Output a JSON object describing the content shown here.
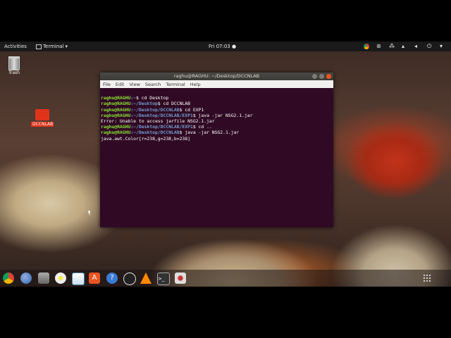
{
  "topbar": {
    "activities": "Activities",
    "app_name": "Terminal",
    "clock": "Fri 07:03 ●"
  },
  "desktop": {
    "trash_label": "Trash",
    "folder_label": "DCCNLAB"
  },
  "terminal": {
    "title": "raghu@RAGHU: ~/Desktop/DCCNLAB",
    "menu": [
      "File",
      "Edit",
      "View",
      "Search",
      "Terminal",
      "Help"
    ],
    "lines": [
      {
        "user": "raghu@RAGHU",
        "path": ":~",
        "cmd": "$ cd Desktop"
      },
      {
        "user": "raghu@RAGHU",
        "path": ":~/Desktop",
        "cmd": "$ cd DCCNLAB"
      },
      {
        "user": "raghu@RAGHU",
        "path": ":~/Desktop/DCCNLAB",
        "cmd": "$ cd EXP1"
      },
      {
        "user": "raghu@RAGHU",
        "path": ":~/Desktop/DCCNLAB/EXP1",
        "cmd": "$ java -jar NSG2.1.jar"
      },
      {
        "output": "Error: Unable to access jarfile NSG2.1.jar"
      },
      {
        "user": "raghu@RAGHU",
        "path": ":~/Desktop/DCCNLAB/EXP1",
        "cmd": "$ cd .."
      },
      {
        "user": "raghu@RAGHU",
        "path": ":~/Desktop/DCCNLAB",
        "cmd": "$ java -jar NSG2.1.jar"
      },
      {
        "output": "java.awt.Color[r=238,g=238,b=238]"
      }
    ]
  },
  "dock": {
    "apps": [
      "chrome-icon",
      "thunderbird-icon",
      "files-icon",
      "rhythmbox-icon",
      "libreoffice-icon",
      "software-center-icon",
      "help-icon",
      "obs-icon",
      "vlc-icon",
      "terminal-icon",
      "settings-icon"
    ]
  }
}
